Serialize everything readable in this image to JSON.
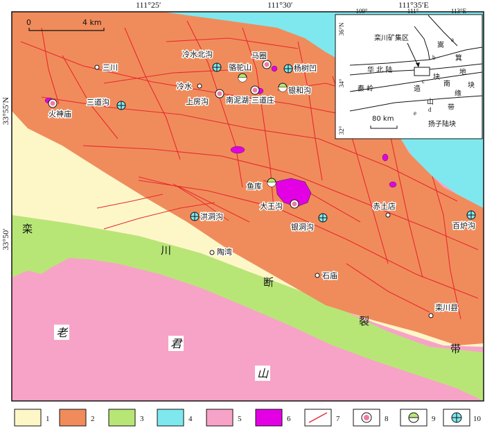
{
  "coords": {
    "top": [
      "111°25′",
      "111°30′",
      "111°35′E"
    ],
    "left": [
      "33°55′N",
      "33°50′"
    ]
  },
  "scale_bar": {
    "start": "0",
    "end": "4 km"
  },
  "places": {
    "lengshui_beigou": "冷水北沟",
    "majuan": "马圈",
    "luotuoshan": "骆驼山",
    "yangshuwa": "杨树凹",
    "sanchuan": "三川",
    "lengshui": "冷水",
    "shangfanggou": "上房沟",
    "nannihu_sandaozhuang": "南泥湖-三道庄",
    "yinhegou": "银和沟",
    "sandaogou": "三道沟",
    "huoshenmiao": "火神庙",
    "yuku": "鱼库",
    "dawanggou": "大王沟",
    "yindonggou": "银洞沟",
    "chitudian": "赤土店",
    "baiugou": "百炉沟",
    "hongdonggou": "洪洞沟",
    "taowan": "陶湾",
    "shimiao": "石庙",
    "luanchuanxian": "栾川县"
  },
  "fault_chars": {
    "c1": "栾",
    "c2": "川",
    "c3": "断",
    "c4": "裂",
    "c5": "带"
  },
  "terrane_chars": {
    "c1": "老",
    "c2": "君",
    "c3": "山"
  },
  "inset": {
    "lon_ticks": [
      "109°",
      "111°",
      "113°E"
    ],
    "lat_ticks": [
      "36°N",
      "34°",
      "32°"
    ],
    "ore_district": "栾川矿集区",
    "song": "嵩",
    "ji": "箕",
    "di": "地",
    "kuai": "块",
    "huabei": "华 北 陆",
    "kuai2": "块",
    "nanyuan": "南",
    "yuan": "缘",
    "qinling": "秦 岭",
    "zao": "造",
    "shan": "山",
    "dai": "带",
    "yangzi": "扬子陆块",
    "scale": "80 km",
    "letters": [
      "a",
      "b",
      "c",
      "d",
      "e"
    ]
  },
  "legend": [
    "1",
    "2",
    "3",
    "4",
    "5",
    "6",
    "7",
    "8",
    "9",
    "10"
  ],
  "colors": {
    "unit1": "#fdf7c8",
    "unit2": "#f08c5c",
    "unit3": "#b8e676",
    "unit4": "#7fe8ef",
    "unit5": "#f7a3c7",
    "unit6": "#e400e4",
    "fault": "#e8282c"
  }
}
